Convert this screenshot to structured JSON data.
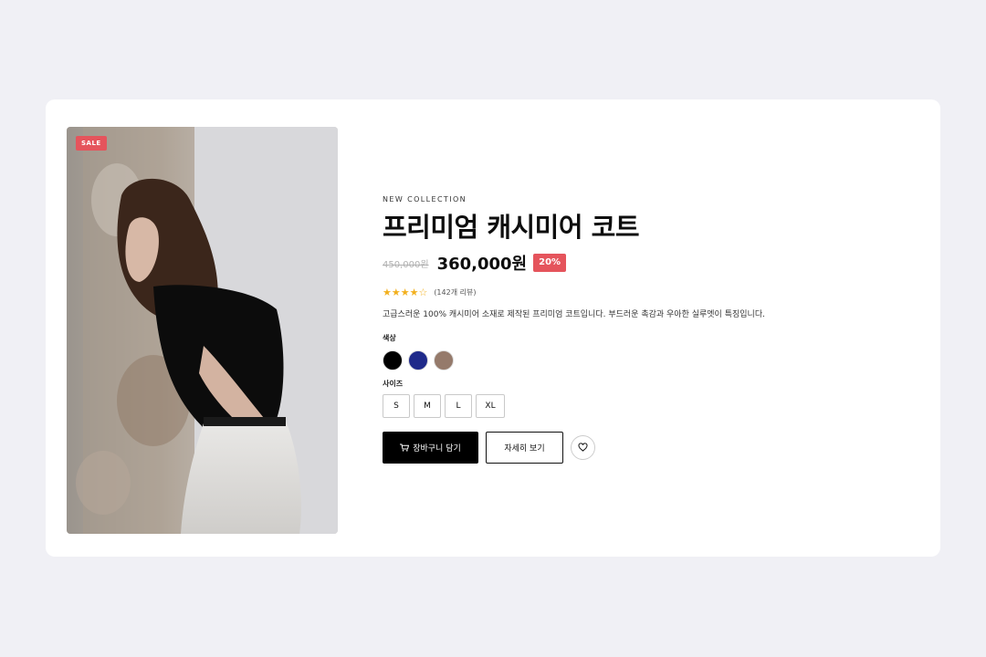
{
  "product": {
    "badge": "SALE",
    "eyebrow": "NEW COLLECTION",
    "title": "프리미엄 캐시미어 코트",
    "original_price": "450,000원",
    "sale_price": "360,000원",
    "discount": "20%",
    "stars": "★★★★☆",
    "rating": 4,
    "review_count": "(142개 리뷰)",
    "description": "고급스러운 100% 캐시미어 소재로 제작된 프리미엄 코트입니다. 부드러운 촉감과 우아한 실루엣이 특징입니다."
  },
  "options": {
    "color_label": "색상",
    "colors": [
      "#000000",
      "#1f2a8a",
      "#957a6b"
    ],
    "size_label": "사이즈",
    "sizes": [
      "S",
      "M",
      "L",
      "XL"
    ]
  },
  "actions": {
    "cart_icon": "cart-icon",
    "cart_label": "장바구니 담기",
    "detail_label": "자세히 보기",
    "wish_icon": "heart-icon"
  },
  "colors": {
    "accent": "#e5545c",
    "star": "#f2b01e",
    "primary_button": "#000000",
    "background": "#f0f0f5"
  }
}
